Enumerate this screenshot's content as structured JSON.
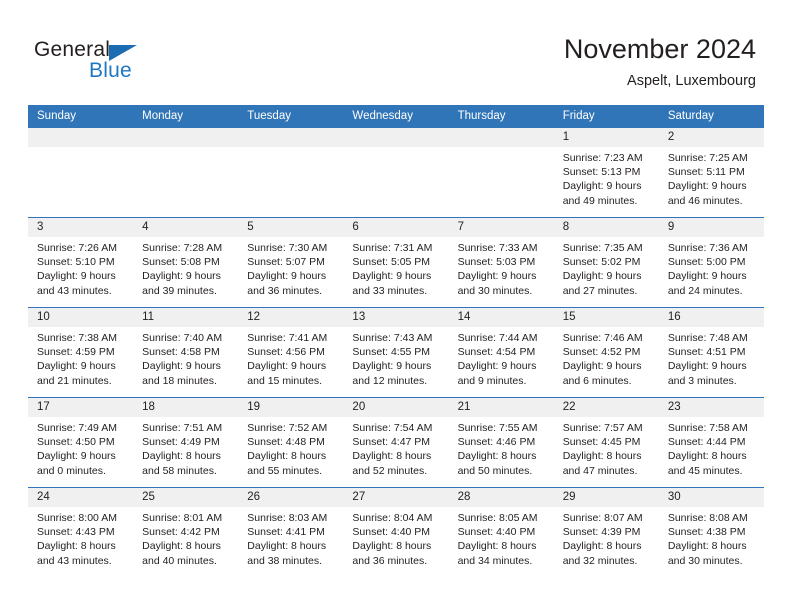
{
  "brand": {
    "name_part1": "General",
    "name_part2": "Blue",
    "accent_color": "#1b6cb3"
  },
  "header": {
    "month_title": "November 2024",
    "location": "Aspelt, Luxembourg"
  },
  "calendar": {
    "header_bg": "#3075b8",
    "date_strip_bg": "#f0f0f0",
    "weekdays": [
      "Sunday",
      "Monday",
      "Tuesday",
      "Wednesday",
      "Thursday",
      "Friday",
      "Saturday"
    ],
    "weeks": [
      [
        {
          "date": "",
          "empty": true,
          "sunrise": "",
          "sunset": "",
          "daylight_line1": "",
          "daylight_line2": ""
        },
        {
          "date": "",
          "empty": true,
          "sunrise": "",
          "sunset": "",
          "daylight_line1": "",
          "daylight_line2": ""
        },
        {
          "date": "",
          "empty": true,
          "sunrise": "",
          "sunset": "",
          "daylight_line1": "",
          "daylight_line2": ""
        },
        {
          "date": "",
          "empty": true,
          "sunrise": "",
          "sunset": "",
          "daylight_line1": "",
          "daylight_line2": ""
        },
        {
          "date": "",
          "empty": true,
          "sunrise": "",
          "sunset": "",
          "daylight_line1": "",
          "daylight_line2": ""
        },
        {
          "date": "1",
          "empty": false,
          "sunrise": "Sunrise: 7:23 AM",
          "sunset": "Sunset: 5:13 PM",
          "daylight_line1": "Daylight: 9 hours",
          "daylight_line2": "and 49 minutes."
        },
        {
          "date": "2",
          "empty": false,
          "sunrise": "Sunrise: 7:25 AM",
          "sunset": "Sunset: 5:11 PM",
          "daylight_line1": "Daylight: 9 hours",
          "daylight_line2": "and 46 minutes."
        }
      ],
      [
        {
          "date": "3",
          "empty": false,
          "sunrise": "Sunrise: 7:26 AM",
          "sunset": "Sunset: 5:10 PM",
          "daylight_line1": "Daylight: 9 hours",
          "daylight_line2": "and 43 minutes."
        },
        {
          "date": "4",
          "empty": false,
          "sunrise": "Sunrise: 7:28 AM",
          "sunset": "Sunset: 5:08 PM",
          "daylight_line1": "Daylight: 9 hours",
          "daylight_line2": "and 39 minutes."
        },
        {
          "date": "5",
          "empty": false,
          "sunrise": "Sunrise: 7:30 AM",
          "sunset": "Sunset: 5:07 PM",
          "daylight_line1": "Daylight: 9 hours",
          "daylight_line2": "and 36 minutes."
        },
        {
          "date": "6",
          "empty": false,
          "sunrise": "Sunrise: 7:31 AM",
          "sunset": "Sunset: 5:05 PM",
          "daylight_line1": "Daylight: 9 hours",
          "daylight_line2": "and 33 minutes."
        },
        {
          "date": "7",
          "empty": false,
          "sunrise": "Sunrise: 7:33 AM",
          "sunset": "Sunset: 5:03 PM",
          "daylight_line1": "Daylight: 9 hours",
          "daylight_line2": "and 30 minutes."
        },
        {
          "date": "8",
          "empty": false,
          "sunrise": "Sunrise: 7:35 AM",
          "sunset": "Sunset: 5:02 PM",
          "daylight_line1": "Daylight: 9 hours",
          "daylight_line2": "and 27 minutes."
        },
        {
          "date": "9",
          "empty": false,
          "sunrise": "Sunrise: 7:36 AM",
          "sunset": "Sunset: 5:00 PM",
          "daylight_line1": "Daylight: 9 hours",
          "daylight_line2": "and 24 minutes."
        }
      ],
      [
        {
          "date": "10",
          "empty": false,
          "sunrise": "Sunrise: 7:38 AM",
          "sunset": "Sunset: 4:59 PM",
          "daylight_line1": "Daylight: 9 hours",
          "daylight_line2": "and 21 minutes."
        },
        {
          "date": "11",
          "empty": false,
          "sunrise": "Sunrise: 7:40 AM",
          "sunset": "Sunset: 4:58 PM",
          "daylight_line1": "Daylight: 9 hours",
          "daylight_line2": "and 18 minutes."
        },
        {
          "date": "12",
          "empty": false,
          "sunrise": "Sunrise: 7:41 AM",
          "sunset": "Sunset: 4:56 PM",
          "daylight_line1": "Daylight: 9 hours",
          "daylight_line2": "and 15 minutes."
        },
        {
          "date": "13",
          "empty": false,
          "sunrise": "Sunrise: 7:43 AM",
          "sunset": "Sunset: 4:55 PM",
          "daylight_line1": "Daylight: 9 hours",
          "daylight_line2": "and 12 minutes."
        },
        {
          "date": "14",
          "empty": false,
          "sunrise": "Sunrise: 7:44 AM",
          "sunset": "Sunset: 4:54 PM",
          "daylight_line1": "Daylight: 9 hours",
          "daylight_line2": "and 9 minutes."
        },
        {
          "date": "15",
          "empty": false,
          "sunrise": "Sunrise: 7:46 AM",
          "sunset": "Sunset: 4:52 PM",
          "daylight_line1": "Daylight: 9 hours",
          "daylight_line2": "and 6 minutes."
        },
        {
          "date": "16",
          "empty": false,
          "sunrise": "Sunrise: 7:48 AM",
          "sunset": "Sunset: 4:51 PM",
          "daylight_line1": "Daylight: 9 hours",
          "daylight_line2": "and 3 minutes."
        }
      ],
      [
        {
          "date": "17",
          "empty": false,
          "sunrise": "Sunrise: 7:49 AM",
          "sunset": "Sunset: 4:50 PM",
          "daylight_line1": "Daylight: 9 hours",
          "daylight_line2": "and 0 minutes."
        },
        {
          "date": "18",
          "empty": false,
          "sunrise": "Sunrise: 7:51 AM",
          "sunset": "Sunset: 4:49 PM",
          "daylight_line1": "Daylight: 8 hours",
          "daylight_line2": "and 58 minutes."
        },
        {
          "date": "19",
          "empty": false,
          "sunrise": "Sunrise: 7:52 AM",
          "sunset": "Sunset: 4:48 PM",
          "daylight_line1": "Daylight: 8 hours",
          "daylight_line2": "and 55 minutes."
        },
        {
          "date": "20",
          "empty": false,
          "sunrise": "Sunrise: 7:54 AM",
          "sunset": "Sunset: 4:47 PM",
          "daylight_line1": "Daylight: 8 hours",
          "daylight_line2": "and 52 minutes."
        },
        {
          "date": "21",
          "empty": false,
          "sunrise": "Sunrise: 7:55 AM",
          "sunset": "Sunset: 4:46 PM",
          "daylight_line1": "Daylight: 8 hours",
          "daylight_line2": "and 50 minutes."
        },
        {
          "date": "22",
          "empty": false,
          "sunrise": "Sunrise: 7:57 AM",
          "sunset": "Sunset: 4:45 PM",
          "daylight_line1": "Daylight: 8 hours",
          "daylight_line2": "and 47 minutes."
        },
        {
          "date": "23",
          "empty": false,
          "sunrise": "Sunrise: 7:58 AM",
          "sunset": "Sunset: 4:44 PM",
          "daylight_line1": "Daylight: 8 hours",
          "daylight_line2": "and 45 minutes."
        }
      ],
      [
        {
          "date": "24",
          "empty": false,
          "sunrise": "Sunrise: 8:00 AM",
          "sunset": "Sunset: 4:43 PM",
          "daylight_line1": "Daylight: 8 hours",
          "daylight_line2": "and 43 minutes."
        },
        {
          "date": "25",
          "empty": false,
          "sunrise": "Sunrise: 8:01 AM",
          "sunset": "Sunset: 4:42 PM",
          "daylight_line1": "Daylight: 8 hours",
          "daylight_line2": "and 40 minutes."
        },
        {
          "date": "26",
          "empty": false,
          "sunrise": "Sunrise: 8:03 AM",
          "sunset": "Sunset: 4:41 PM",
          "daylight_line1": "Daylight: 8 hours",
          "daylight_line2": "and 38 minutes."
        },
        {
          "date": "27",
          "empty": false,
          "sunrise": "Sunrise: 8:04 AM",
          "sunset": "Sunset: 4:40 PM",
          "daylight_line1": "Daylight: 8 hours",
          "daylight_line2": "and 36 minutes."
        },
        {
          "date": "28",
          "empty": false,
          "sunrise": "Sunrise: 8:05 AM",
          "sunset": "Sunset: 4:40 PM",
          "daylight_line1": "Daylight: 8 hours",
          "daylight_line2": "and 34 minutes."
        },
        {
          "date": "29",
          "empty": false,
          "sunrise": "Sunrise: 8:07 AM",
          "sunset": "Sunset: 4:39 PM",
          "daylight_line1": "Daylight: 8 hours",
          "daylight_line2": "and 32 minutes."
        },
        {
          "date": "30",
          "empty": false,
          "sunrise": "Sunrise: 8:08 AM",
          "sunset": "Sunset: 4:38 PM",
          "daylight_line1": "Daylight: 8 hours",
          "daylight_line2": "and 30 minutes."
        }
      ]
    ]
  }
}
